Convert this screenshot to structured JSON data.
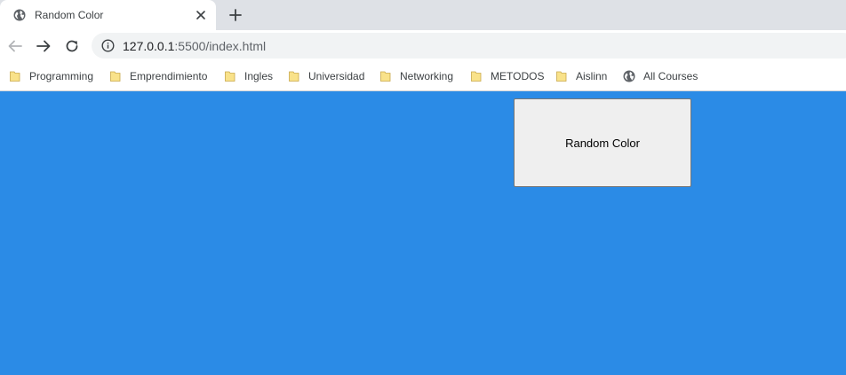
{
  "tab": {
    "title": "Random Color",
    "favicon": "globe-icon",
    "close_icon": "close-icon"
  },
  "new_tab_icon": "plus-icon",
  "toolbar": {
    "back_icon": "arrow-left-icon",
    "forward_icon": "arrow-right-icon",
    "reload_icon": "reload-icon",
    "info_icon": "info-icon",
    "url_host": "127.0.0.1",
    "url_rest": ":5500/index.html"
  },
  "bookmarks": [
    {
      "label": "Programming",
      "icon": "folder-icon"
    },
    {
      "label": "Emprendimiento",
      "icon": "folder-icon"
    },
    {
      "label": "Ingles",
      "icon": "folder-icon"
    },
    {
      "label": "Universidad",
      "icon": "folder-icon"
    },
    {
      "label": "Networking",
      "icon": "folder-icon"
    },
    {
      "label": "METODOS",
      "icon": "folder-icon"
    },
    {
      "label": "Aislinn",
      "icon": "folder-icon"
    },
    {
      "label": "All Courses",
      "icon": "globe-icon"
    }
  ],
  "page": {
    "background_color": "#2b8be6",
    "button_label": "Random Color"
  }
}
